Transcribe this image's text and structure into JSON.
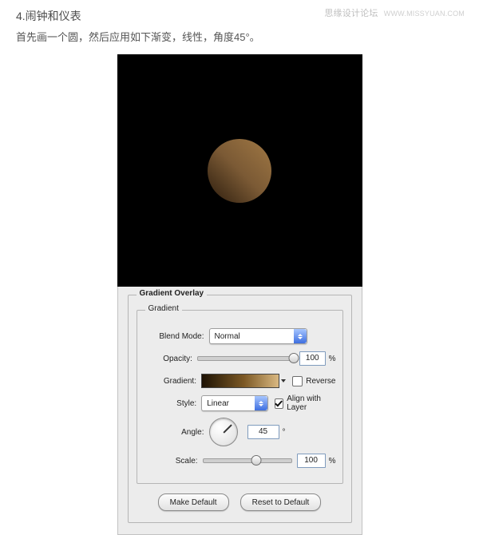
{
  "watermark": {
    "site": "思缘设计论坛",
    "url": "WWW.MISSYUAN.COM"
  },
  "article": {
    "heading": "4.闹钟和仪表",
    "instruction": "首先画一个圆，然后应用如下渐变，线性，角度45°。"
  },
  "panel": {
    "legend_outer": "Gradient Overlay",
    "legend_inner": "Gradient",
    "blend_mode": {
      "label": "Blend Mode:",
      "value": "Normal"
    },
    "opacity": {
      "label": "Opacity:",
      "value": "100",
      "unit": "%"
    },
    "gradient": {
      "label": "Gradient:",
      "reverse_label": "Reverse",
      "reverse_checked": false,
      "stops": [
        "#1d1204",
        "#7c5925",
        "#d9b881"
      ]
    },
    "style": {
      "label": "Style:",
      "value": "Linear",
      "align_label": "Align with Layer",
      "align_checked": true
    },
    "angle": {
      "label": "Angle:",
      "value": "45",
      "unit": "°"
    },
    "scale": {
      "label": "Scale:",
      "value": "100",
      "unit": "%"
    },
    "buttons": {
      "make_default": "Make Default",
      "reset_default": "Reset to Default"
    }
  }
}
